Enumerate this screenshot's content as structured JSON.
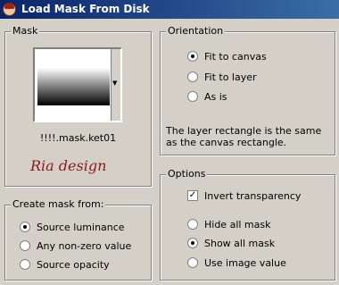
{
  "window": {
    "title": "Load Mask From Disk"
  },
  "mask": {
    "group_label": "Mask",
    "file_name": "!!!!.mask.ket01",
    "brand_text": "Ria design"
  },
  "create_from": {
    "group_label": "Create mask from:",
    "options": [
      {
        "label": "Source luminance",
        "selected": true
      },
      {
        "label": "Any non-zero value",
        "selected": false
      },
      {
        "label": "Source opacity",
        "selected": false
      }
    ]
  },
  "orientation": {
    "group_label": "Orientation",
    "options": [
      {
        "label": "Fit to canvas",
        "selected": true
      },
      {
        "label": "Fit to layer",
        "selected": false
      },
      {
        "label": "As is",
        "selected": false
      }
    ],
    "info_text": "The layer rectangle is the same as the canvas rectangle."
  },
  "options": {
    "group_label": "Options",
    "invert_label": "Invert transparency",
    "invert_checked": true,
    "visibility": [
      {
        "label": "Hide all mask",
        "selected": false
      },
      {
        "label": "Show all mask",
        "selected": true
      },
      {
        "label": "Use image value",
        "selected": false
      }
    ]
  }
}
